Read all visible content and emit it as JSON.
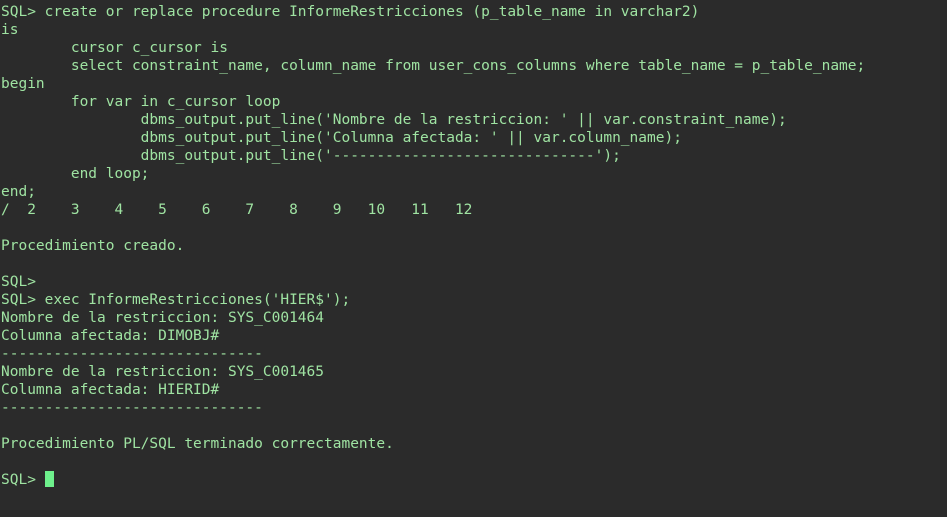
{
  "terminal": {
    "lines": [
      "SQL> create or replace procedure InformeRestricciones (p_table_name in varchar2)",
      "is",
      "        cursor c_cursor is",
      "        select constraint_name, column_name from user_cons_columns where table_name = p_table_name;",
      "begin",
      "        for var in c_cursor loop",
      "                dbms_output.put_line('Nombre de la restriccion: ' || var.constraint_name);",
      "                dbms_output.put_line('Columna afectada: ' || var.column_name);",
      "                dbms_output.put_line('------------------------------');",
      "        end loop;",
      "end;",
      "/  2    3    4    5    6    7    8    9   10   11   12",
      "",
      "Procedimiento creado.",
      "",
      "SQL>",
      "SQL> exec InformeRestricciones('HIER$');",
      "Nombre de la restriccion: SYS_C001464",
      "Columna afectada: DIMOBJ#",
      "------------------------------",
      "Nombre de la restriccion: SYS_C001465",
      "Columna afectada: HIERID#",
      "------------------------------",
      "",
      "Procedimiento PL/SQL terminado correctamente.",
      ""
    ],
    "prompt": "SQL> ",
    "colors": {
      "background": "#2b2b2b",
      "text": "#9fe3a2",
      "cursor": "#6ef08c"
    }
  }
}
